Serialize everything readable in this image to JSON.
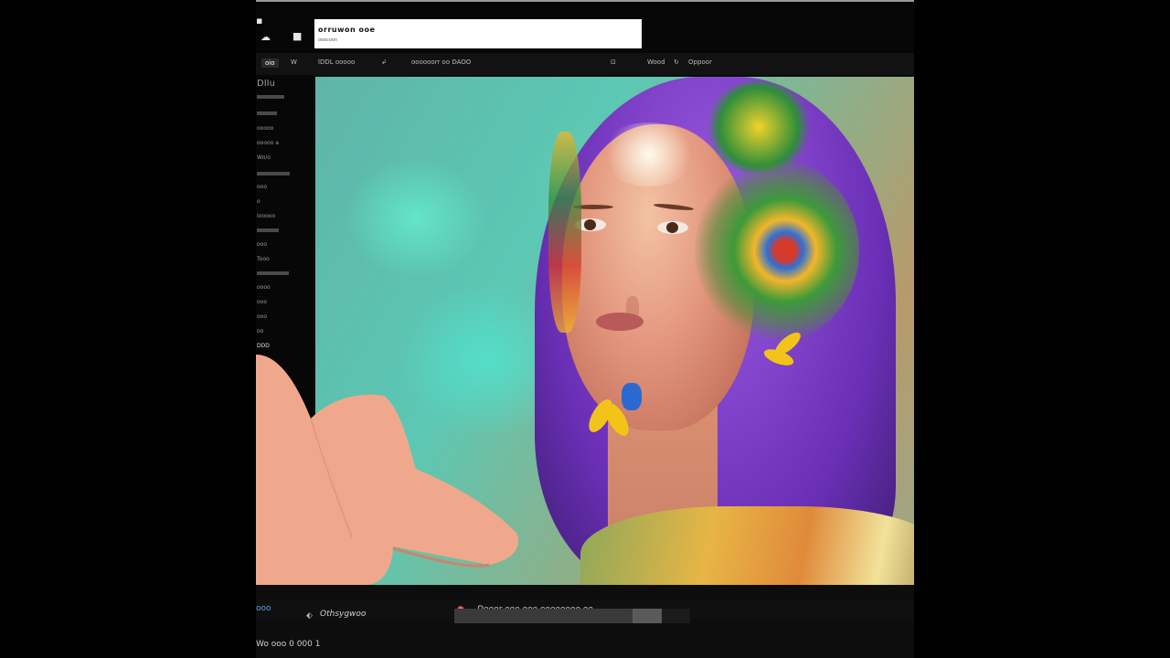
{
  "window": {
    "url_line1": "orruwon  ooe",
    "url_line2": "ooocoon"
  },
  "toolbar": {
    "tab1": "oio",
    "tab2": "W",
    "item1": "lDDL ooooo",
    "item2": "oooooorr oo  DAOO",
    "item3": "Wood",
    "item4": "Oppoor"
  },
  "sidebar": {
    "items": [
      "DIIu",
      "ooooo",
      "ooooo a",
      "Wo/o",
      "ooo",
      "o",
      "Iooooo",
      "ooo",
      "Tooo",
      "oooo",
      "ooo",
      "ooo",
      "oo",
      "DDD"
    ]
  },
  "bottom": {
    "left_label": "ooo",
    "caption": "Othsygwoo",
    "status": "Dooor ooo  ooo oooooooo oo",
    "footer": "Wo ooo 0 000 1",
    "progress": 0.88
  },
  "colors": {
    "background": "#000000",
    "panel": "#0b0b0b",
    "hair": "#7b3fd1",
    "sky": "#5cc8b4"
  }
}
